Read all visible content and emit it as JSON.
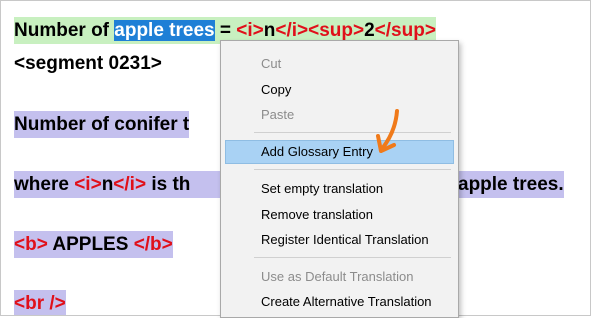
{
  "editor": {
    "line1": {
      "text_before": "Number of ",
      "selected": "apple trees",
      "eq": " = ",
      "i_open": "<i>",
      "n": "n",
      "i_close": "</i>",
      "sup_open": "<sup>",
      "two": "2",
      "sup_close": "</sup>"
    },
    "segment_marker": "<segment 0231>",
    "line3": {
      "text": "Number of conifer t"
    },
    "line4": {
      "where": "where ",
      "i_open": "<i>",
      "n": "n",
      "i_close": "</i>",
      "is": " is th",
      "rest": "apple trees."
    },
    "line5": {
      "b_open": "<b>",
      "apples": " APPLES ",
      "b_close": "</b>"
    },
    "line6": {
      "br": "<br />"
    }
  },
  "context_menu": {
    "items": [
      {
        "label": "Cut",
        "enabled": false
      },
      {
        "label": "Copy",
        "enabled": true
      },
      {
        "label": "Paste",
        "enabled": false
      },
      {
        "label": "Add Glossary Entry",
        "enabled": true,
        "highlighted": true
      },
      {
        "label": "Set empty translation",
        "enabled": true
      },
      {
        "label": "Remove translation",
        "enabled": true
      },
      {
        "label": "Register Identical Translation",
        "enabled": true
      },
      {
        "label": "Use as Default Translation",
        "enabled": false
      },
      {
        "label": "Create Alternative Translation",
        "enabled": true
      }
    ]
  },
  "colors": {
    "selection": "#1e7fd6",
    "tag": "#e0101a",
    "segment_active_bg": "#c8f0c0",
    "segment_bg": "#c4c0ee",
    "menu_highlight": "#a9d2f4",
    "annotation_arrow": "#f07a1a"
  },
  "icons": {
    "annotation": "arrow-annotation-icon"
  }
}
